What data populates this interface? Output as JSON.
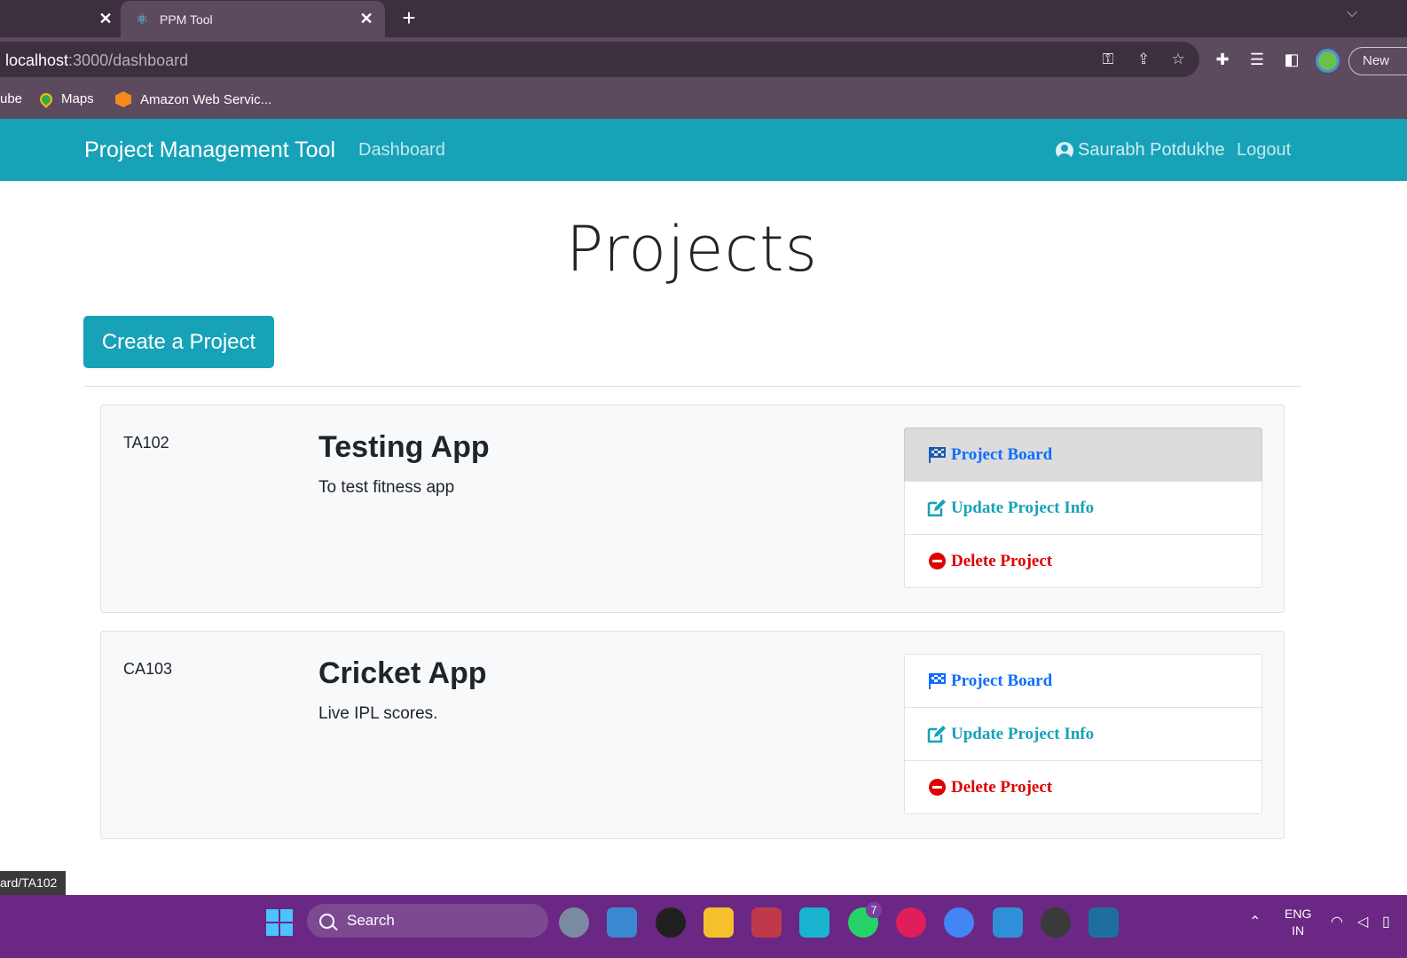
{
  "browser": {
    "tabs": [
      {
        "title": ""
      },
      {
        "title": "PPM Tool",
        "active": true
      }
    ],
    "url_host": "localhost",
    "url_path": ":3000/dashboard",
    "profile_button": "New",
    "bookmarks": [
      {
        "label": "ube"
      },
      {
        "label": "Maps"
      },
      {
        "label": "Amazon Web Servic..."
      }
    ],
    "status_url": "ard/TA102"
  },
  "navbar": {
    "brand": "Project Management Tool",
    "dashboard": "Dashboard",
    "user": "Saurabh Potdukhe",
    "logout": "Logout",
    "color": "#17a2b8"
  },
  "page": {
    "title": "Projects",
    "create_button": "Create a Project"
  },
  "projects": [
    {
      "id": "TA102",
      "name": "Testing App",
      "description": "To test fitness app",
      "actions": {
        "board": "Project Board",
        "update": "Update Project Info",
        "delete": "Delete Project"
      }
    },
    {
      "id": "CA103",
      "name": "Cricket App",
      "description": "Live IPL scores.",
      "actions": {
        "board": "Project Board",
        "update": "Update Project Info",
        "delete": "Delete Project"
      }
    }
  ],
  "taskbar": {
    "search": "Search",
    "whatsapp_badge": "7",
    "lang_line1": "ENG",
    "lang_line2": "IN"
  },
  "icons": [
    "react-icon",
    "key-icon",
    "share-icon",
    "star-icon",
    "extension-icon",
    "media-icon",
    "sidepanel-icon",
    "flag-checkered-icon",
    "edit-icon",
    "minus-circle-icon",
    "user-circle-icon",
    "windows-icon",
    "search-icon"
  ]
}
